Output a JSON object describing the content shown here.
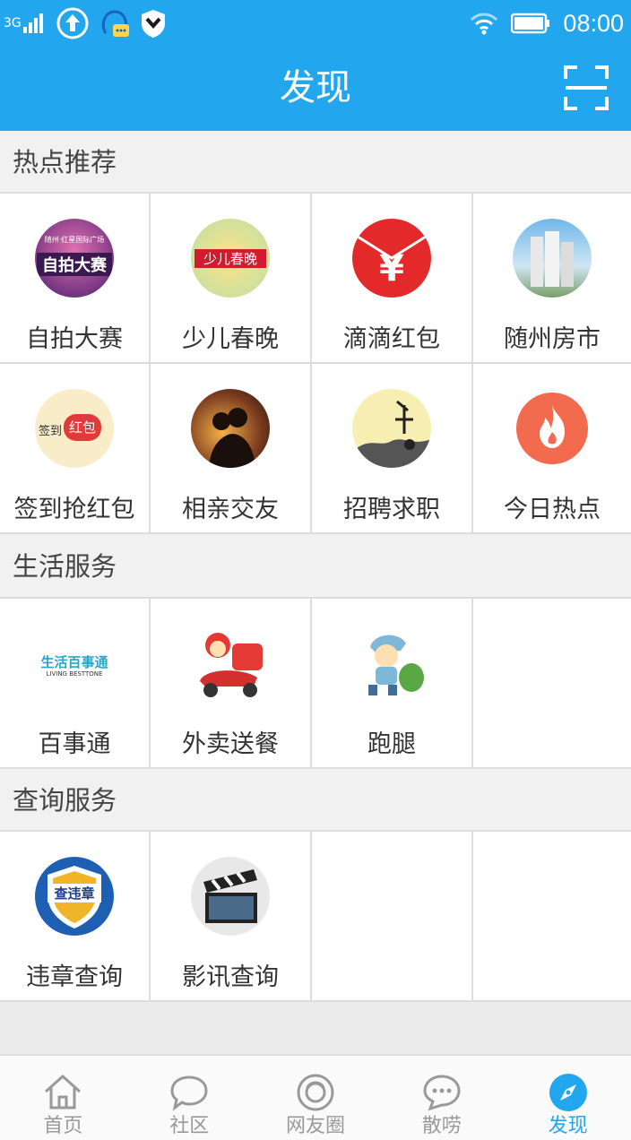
{
  "status_bar": {
    "network": "3G",
    "time": "08:00"
  },
  "header": {
    "title": "发现"
  },
  "sections": [
    {
      "title": "热点推荐",
      "items": [
        {
          "label": "自拍大赛",
          "icon": "selfie-contest-icon"
        },
        {
          "label": "少儿春晚",
          "icon": "kids-gala-icon"
        },
        {
          "label": "滴滴红包",
          "icon": "red-envelope-icon"
        },
        {
          "label": "随州房市",
          "icon": "housing-icon"
        },
        {
          "label": "签到抢红包",
          "icon": "checkin-red-packet-icon"
        },
        {
          "label": "相亲交友",
          "icon": "dating-icon"
        },
        {
          "label": "招聘求职",
          "icon": "jobs-icon"
        },
        {
          "label": "今日热点",
          "icon": "hot-fire-icon"
        }
      ]
    },
    {
      "title": "生活服务",
      "items": [
        {
          "label": "百事通",
          "icon": "life-services-icon",
          "badge_text": "生活百事通",
          "badge_sub": "LIVING BESTTONE"
        },
        {
          "label": "外卖送餐",
          "icon": "food-delivery-icon"
        },
        {
          "label": "跑腿",
          "icon": "errand-runner-icon"
        }
      ]
    },
    {
      "title": "查询服务",
      "items": [
        {
          "label": "违章查询",
          "icon": "traffic-violation-icon",
          "badge_text": "查违章"
        },
        {
          "label": "影讯查询",
          "icon": "movie-clapper-icon"
        }
      ]
    }
  ],
  "hot_icon_texts": {
    "selfie_top": "随州·红星国际广场",
    "selfie_main": "自拍大赛",
    "kids_gala": "少儿春晚",
    "yuan": "¥",
    "checkin_left": "签到",
    "checkin_right": "红包"
  },
  "bottom_nav": [
    {
      "label": "首页",
      "icon": "home-icon",
      "active": false
    },
    {
      "label": "社区",
      "icon": "chat-bubble-icon",
      "active": false
    },
    {
      "label": "网友圈",
      "icon": "friends-circle-icon",
      "active": false
    },
    {
      "label": "散唠",
      "icon": "chat-dots-icon",
      "active": false
    },
    {
      "label": "发现",
      "icon": "compass-icon",
      "active": true
    }
  ],
  "colors": {
    "primary": "#22a7ee",
    "red_envelope": "#e53935",
    "fire": "#f26b4f"
  }
}
